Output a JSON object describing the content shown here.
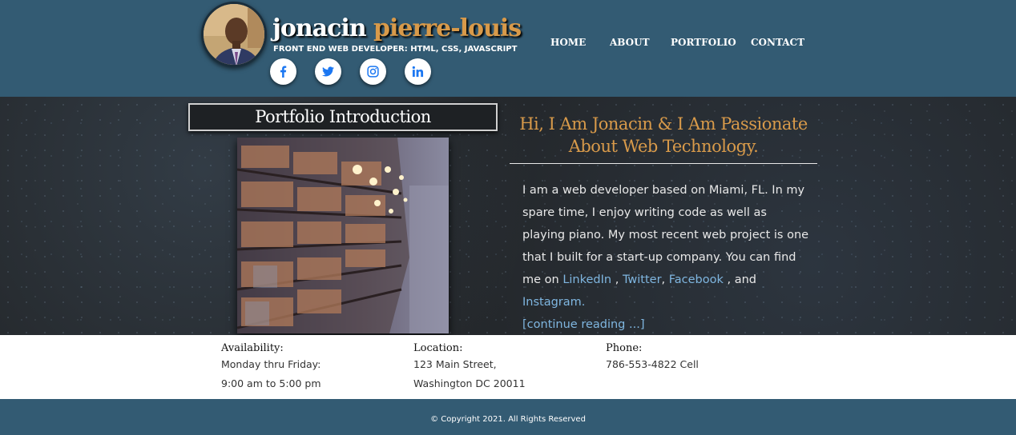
{
  "header": {
    "first_name": "jonacin",
    "last_name": "pierre-louis",
    "tagline": "FRONT END WEB DEVELOPER: HTML, CSS, JAVASCRIPT",
    "social": [
      {
        "icon": "facebook-icon",
        "color": "#1b77f2"
      },
      {
        "icon": "twitter-icon",
        "color": "#1b77f2"
      },
      {
        "icon": "instagram-icon",
        "color": "#1b77f2"
      },
      {
        "icon": "linkedin-icon",
        "color": "#1b77f2"
      }
    ],
    "nav": [
      "HOME",
      "ABOUT",
      "PORTFOLIO",
      "CONTACT"
    ]
  },
  "hero": {
    "intro_title": "Portfolio Introduction",
    "heading_line1": "Hi, I Am Jonacin & I Am Passionate",
    "heading_line2": "About Web Technology.",
    "body_text": "I am a web developer based on Miami, FL. In my spare time, I enjoy writing code as well as playing piano. My most recent web project is one that I built for a start-up company. You can find me on",
    "link_linkedin": "LinkedIn",
    "sep1": " , ",
    "link_twitter": "Twitter",
    "sep2": ", ",
    "link_facebook": "Facebook",
    "sep3": " , and ",
    "link_instagram": "Instagram.",
    "continue": "[continue reading ...]"
  },
  "contact": {
    "availability_label": "Availability:",
    "availability_line1": "Monday thru Friday:",
    "availability_line2": "9:00 am to 5:00 pm",
    "location_label": "Location:",
    "location_line1": "123 Main Street,",
    "location_line2": "Washington DC 20011",
    "phone_label": "Phone:",
    "phone_line1": "786-553-4822 Cell"
  },
  "footer": {
    "copyright": "© Copyright 2021. All Rights Reserved"
  },
  "colors": {
    "header_bg": "#335b73",
    "accent_orange": "#d89a4a",
    "link_blue": "#7fb6e0"
  }
}
